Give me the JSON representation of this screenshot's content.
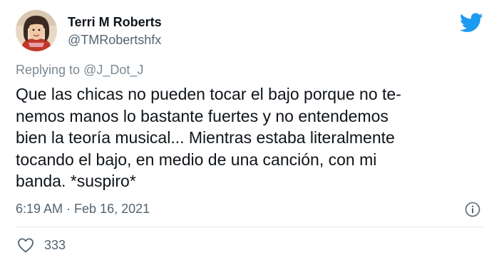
{
  "user": {
    "display_name": "Terri M Roberts",
    "handle": "@TMRobertshfx"
  },
  "reply": {
    "prefix": "Replying to ",
    "target": "@J_Dot_J"
  },
  "tweet": {
    "lines": [
      "Que las chicas no pueden tocar el bajo porque no te-",
      "nemos manos lo bastante fuertes y no entendemos",
      "bien la teoría musical... Mientras estaba literalmente",
      "tocando el bajo, en medio de una canción, con mi",
      "banda. *suspiro*"
    ],
    "time": "6:19 AM",
    "separator": " · ",
    "date": "Feb 16, 2021"
  },
  "stats": {
    "likes": "333"
  },
  "icons": {
    "brand": "twitter-bird-icon",
    "info": "info-icon",
    "like": "heart-icon"
  },
  "colors": {
    "brand": "#1d9bf0",
    "text": "#0f1419",
    "secondary": "#536471"
  }
}
